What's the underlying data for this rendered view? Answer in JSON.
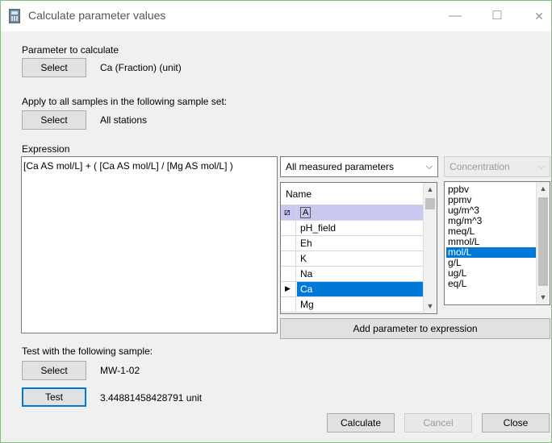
{
  "window": {
    "title": "Calculate parameter values",
    "minimize": "—",
    "maximize": "☐",
    "close": "✕"
  },
  "param_section": {
    "label": "Parameter to calculate",
    "button": "Select",
    "value": "Ca (Fraction) (unit)"
  },
  "sampleset_section": {
    "label": "Apply to all samples in the following sample set:",
    "button": "Select",
    "value": "All stations"
  },
  "expression": {
    "label": "Expression",
    "text": "[Ca AS mol/L] + ( [Ca AS mol/L] / [Mg AS mol/L] )"
  },
  "parameter_filter": {
    "selected": "All measured parameters"
  },
  "unit_type": {
    "selected": "Concentration"
  },
  "parameter_grid": {
    "header": "Name",
    "filter_icon": "⧄",
    "filter_value": "A",
    "current_row_marker": "▶",
    "rows": [
      "pH_field",
      "Eh",
      "K",
      "Na",
      "Ca",
      "Mg"
    ],
    "selected_index": 4
  },
  "units_list": {
    "items": [
      "ppbv",
      "ppmv",
      "ug/m^3",
      "mg/m^3",
      "meq/L",
      "mmol/L",
      "mol/L",
      "g/L",
      "ug/L",
      "eq/L"
    ],
    "selected_index": 6
  },
  "add_button": "Add parameter to expression",
  "test_section": {
    "label": "Test with the following sample:",
    "select_button": "Select",
    "sample": "MW-1-02",
    "test_button": "Test",
    "result": "3.44881458428791 unit"
  },
  "footer": {
    "calculate": "Calculate",
    "cancel": "Cancel",
    "close": "Close"
  },
  "colors": {
    "selection": "#0078d7",
    "filter_row": "#c8c8f0",
    "window_border": "#7fbf7f"
  }
}
